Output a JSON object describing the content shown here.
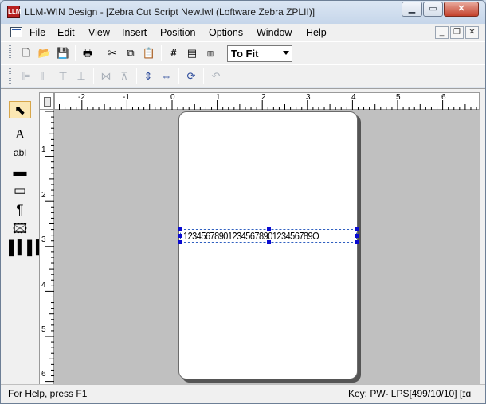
{
  "window": {
    "title": "LLM-WIN Design - [Zebra Cut Script New.lwl (Loftware Zebra ZPLII)]",
    "icon_text": "LLM"
  },
  "menu": {
    "items": [
      "File",
      "Edit",
      "View",
      "Insert",
      "Position",
      "Options",
      "Window",
      "Help"
    ]
  },
  "toolbar": {
    "zoom_value": "To Fit"
  },
  "ruler": {
    "horizontal_labels": [
      "-2",
      "-1",
      "0",
      "1",
      "2",
      "3",
      "4",
      "5",
      "6"
    ],
    "vertical_labels": [
      "1",
      "2",
      "3",
      "4",
      "5",
      "6"
    ]
  },
  "label": {
    "barcode_text": "12345678901234567890123456789O"
  },
  "status": {
    "help": "For Help, press F1",
    "key": "Key: PW- LPS[499/10/10] [ɪɑ"
  }
}
